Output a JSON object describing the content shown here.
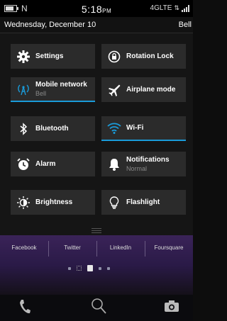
{
  "status_bar": {
    "time": "5:18",
    "ampm": "PM",
    "network": "4GLTE",
    "nfc_symbol": "N",
    "battery_level": 0.75
  },
  "date_row": {
    "date": "Wednesday, December 10",
    "carrier": "Bell"
  },
  "quick_settings": {
    "settings": {
      "label": "Settings"
    },
    "rotation_lock": {
      "label": "Rotation Lock"
    },
    "mobile_network": {
      "label": "Mobile network",
      "sub": "Bell"
    },
    "airplane_mode": {
      "label": "Airplane mode"
    },
    "bluetooth": {
      "label": "Bluetooth"
    },
    "wifi": {
      "label": "Wi-Fi"
    },
    "alarm": {
      "label": "Alarm"
    },
    "notifications": {
      "label": "Notifications",
      "sub": "Normal"
    },
    "brightness": {
      "label": "Brightness"
    },
    "flashlight": {
      "label": "Flashlight"
    }
  },
  "home": {
    "apps": [
      "Facebook",
      "Twitter",
      "LinkedIn",
      "Foursquare"
    ]
  },
  "colors": {
    "accent": "#1a9bd9",
    "tile_bg": "#2b2b2b"
  }
}
